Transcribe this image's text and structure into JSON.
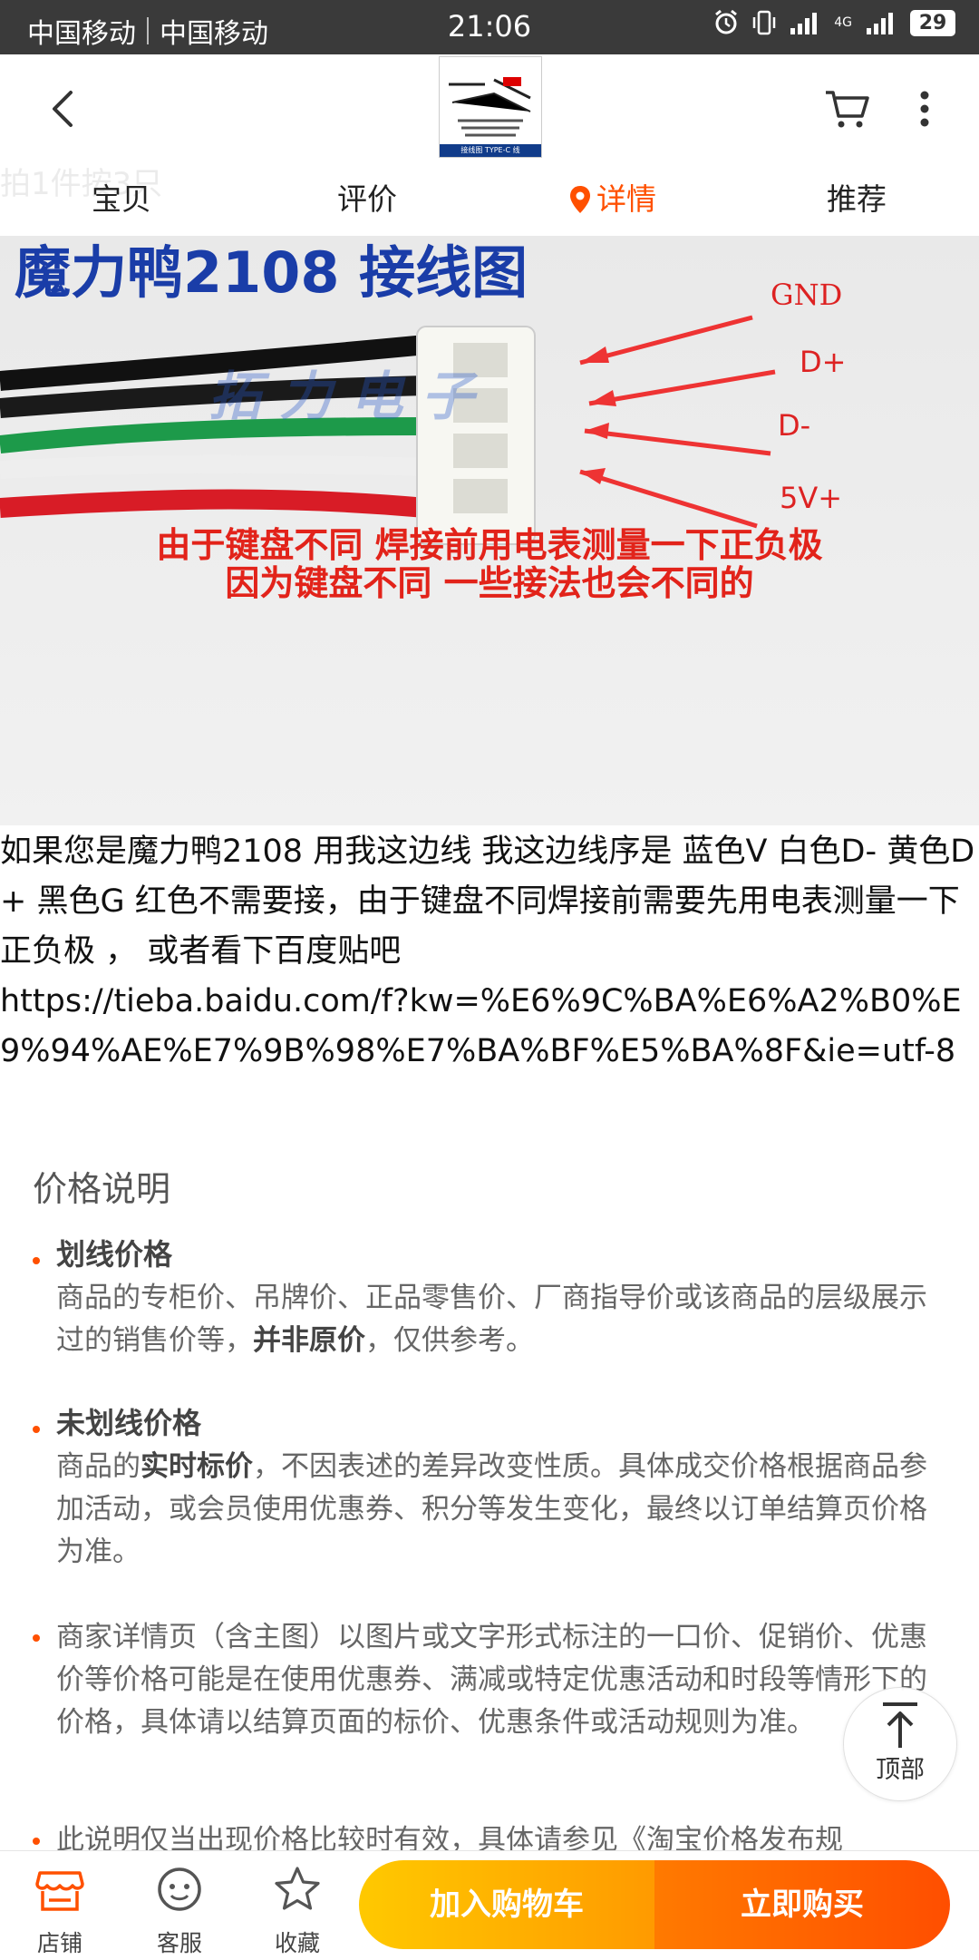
{
  "status_bar": {
    "carrier1": "中国移动",
    "carrier2": "中国移动",
    "time": "21:06",
    "network": "4G",
    "battery": "29"
  },
  "nav": {
    "ghost_text": "拍1件按3只",
    "tabs": [
      "宝贝",
      "评价",
      "详情",
      "推荐"
    ],
    "active_tab": "详情",
    "thumbnail_caption": "接线图 TYPE-C 线"
  },
  "product_image": {
    "title": "魔力鸭2108 接线图",
    "labels": [
      "GND",
      "D+",
      "D-",
      "5V+"
    ],
    "watermark": "拓 力 电 子",
    "warning_line1": "由于键盘不同 焊接前用电表测量一下正负极",
    "warning_line2": "因为键盘不同 一些接法也会不同的"
  },
  "description": {
    "line1": "如果您是魔力鸭2108 用我这边线 我这边线序是 蓝色V 白色D- 黄色D+ 黑色G 红色不需要接，由于键盘不同焊接前需要先用电表测量一下正负极 ， 或者看下百度贴吧",
    "url": "https://tieba.baidu.com/f?kw=%E6%9C%BA%E6%A2%B0%E9%94%AE%E7%9B%98%E7%BA%BF%E5%BA%8F&ie=utf-8"
  },
  "price_section": {
    "title": "价格说明",
    "items": [
      {
        "title": "划线价格",
        "body_pre": "商品的专柜价、吊牌价、正品零售价、厂商指导价或该商品的层级展示过的销售价等，",
        "body_bold": "并非原价",
        "body_post": "，仅供参考。"
      },
      {
        "title": "未划线价格",
        "body_pre": "商品的",
        "body_bold": "实时标价",
        "body_post": "，不因表述的差异改变性质。具体成交价格根据商品参加活动，或会员使用优惠券、积分等发生变化，最终以订单结算页价格为准。"
      },
      {
        "body": "商家详情页（含主图）以图片或文字形式标注的一口价、促销价、优惠价等价格可能是在使用优惠券、满减或特定优惠活动和时段等情形下的价格，具体请以结算页面的标价、优惠条件或活动规则为准。"
      },
      {
        "body": "此说明仅当出现价格比较时有效，具体请参见《淘宝价格发布规"
      }
    ]
  },
  "back_to_top": {
    "label": "顶部"
  },
  "bottom_bar": {
    "shop": "店铺",
    "service": "客服",
    "favorite": "收藏",
    "add_to_cart": "加入购物车",
    "buy_now": "立即购买"
  },
  "colors": {
    "accent": "#ff5000",
    "cart_gradient": [
      "#ffc900",
      "#ff9a00"
    ],
    "buy_gradient": [
      "#ff7a00",
      "#ff4e00"
    ]
  }
}
